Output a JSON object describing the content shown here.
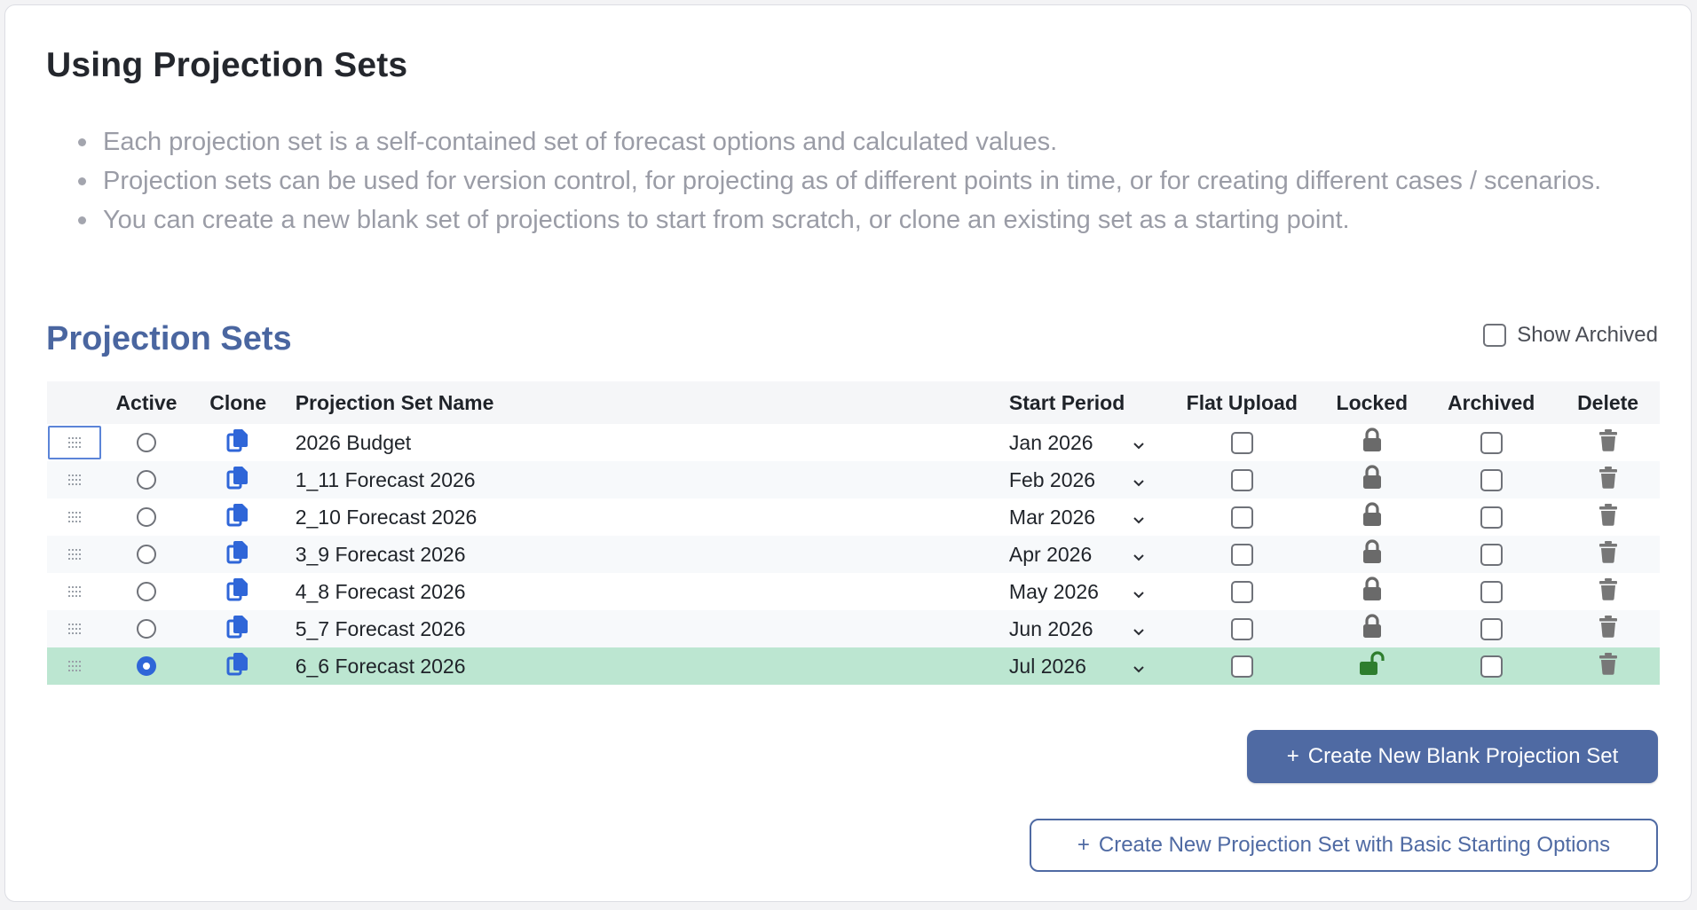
{
  "intro": {
    "title": "Using Projection Sets",
    "bullets": [
      "Each projection set is a self-contained set of forecast options and calculated values.",
      "Projection sets can be used for version control, for projecting as of different points in time, or for creating different cases / scenarios.",
      "You can create a new blank set of projections to start from scratch, or clone an existing set as a starting point."
    ]
  },
  "projection_sets": {
    "title": "Projection Sets",
    "show_archived_label": "Show Archived",
    "show_archived_checked": false,
    "columns": {
      "active": "Active",
      "clone": "Clone",
      "name": "Projection Set Name",
      "start_period": "Start Period",
      "flat_upload": "Flat Upload",
      "locked": "Locked",
      "archived": "Archived",
      "delete": "Delete"
    },
    "rows": [
      {
        "name": "2026 Budget",
        "start_period": "Jan 2026",
        "active": false,
        "flat_upload": false,
        "locked": true,
        "archived": false
      },
      {
        "name": "1_11 Forecast 2026",
        "start_period": "Feb 2026",
        "active": false,
        "flat_upload": false,
        "locked": true,
        "archived": false
      },
      {
        "name": "2_10 Forecast 2026",
        "start_period": "Mar 2026",
        "active": false,
        "flat_upload": false,
        "locked": true,
        "archived": false
      },
      {
        "name": "3_9 Forecast 2026",
        "start_period": "Apr 2026",
        "active": false,
        "flat_upload": false,
        "locked": true,
        "archived": false
      },
      {
        "name": "4_8 Forecast 2026",
        "start_period": "May 2026",
        "active": false,
        "flat_upload": false,
        "locked": true,
        "archived": false
      },
      {
        "name": "5_7 Forecast 2026",
        "start_period": "Jun 2026",
        "active": false,
        "flat_upload": false,
        "locked": true,
        "archived": false
      },
      {
        "name": "6_6 Forecast 2026",
        "start_period": "Jul 2026",
        "active": true,
        "flat_upload": false,
        "locked": false,
        "archived": false
      }
    ]
  },
  "buttons": {
    "create_blank": "Create New Blank Projection Set",
    "create_basic": "Create New Projection Set with Basic Starting Options",
    "plus_symbol": "+"
  },
  "colors": {
    "accent": "#4f6aa3",
    "active_row": "#bce6d1",
    "clone_icon": "#2f66d8",
    "locked_icon": "#6a6a6a",
    "unlocked_icon": "#2e7d2e",
    "muted_text": "#9a9ca6"
  },
  "icons": {
    "drag": "drag-handle-icon",
    "clone": "copy-icon",
    "locked": "lock-icon",
    "unlocked": "unlock-icon",
    "delete": "trash-icon",
    "dropdown": "chevron-down-icon"
  }
}
